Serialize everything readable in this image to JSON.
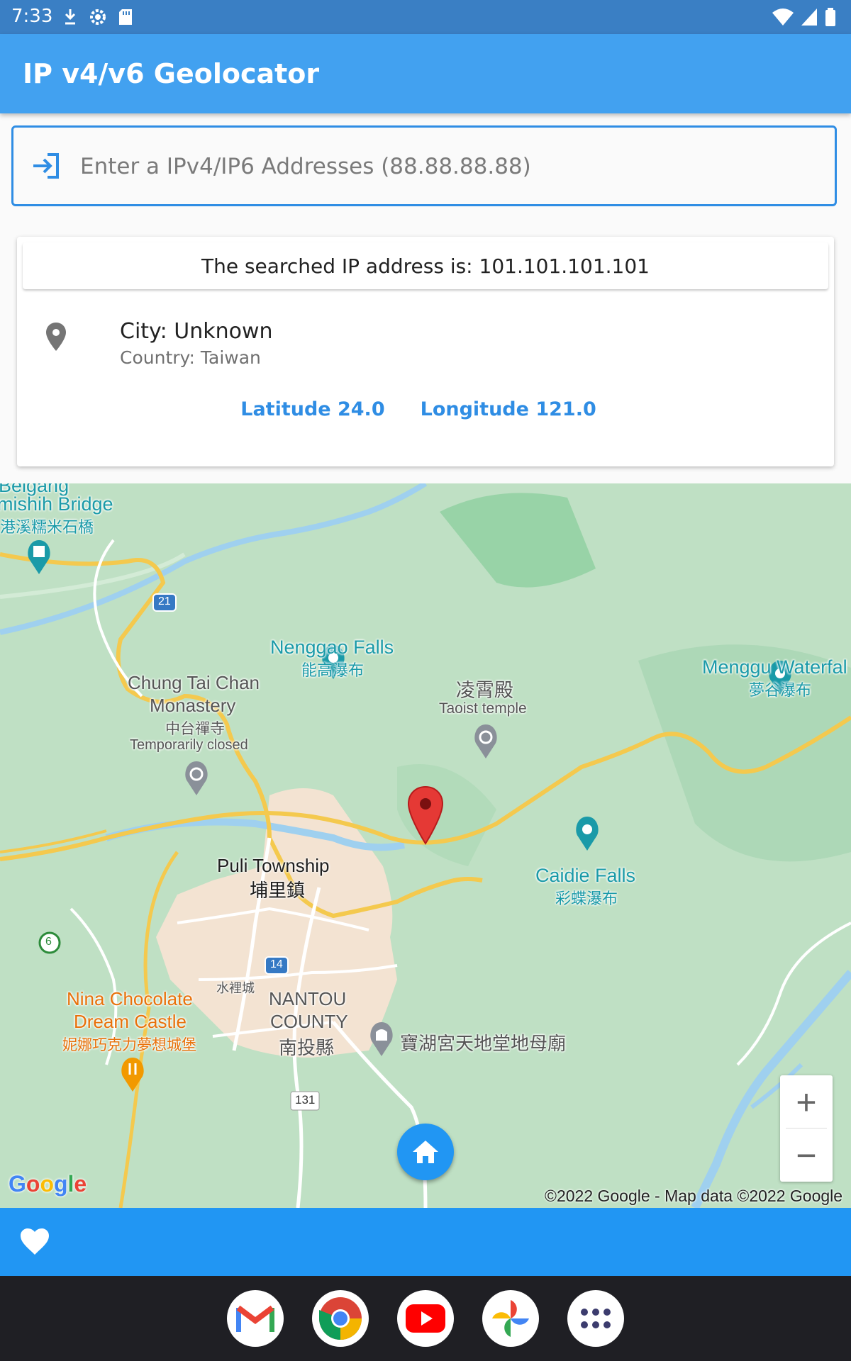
{
  "status_bar": {
    "time": "7:33"
  },
  "app_bar": {
    "title": "IP v4/v6 Geolocator"
  },
  "search": {
    "placeholder": "Enter a IPv4/IP6 Addresses (88.88.88.88)",
    "value": ""
  },
  "result": {
    "header": "The searched IP address is: 101.101.101.101",
    "city": "City: Unknown",
    "country": "Country: Taiwan",
    "latitude": "Latitude 24.0",
    "longitude": "Longitude 121.0"
  },
  "map": {
    "labels": {
      "beigang": "Beigang",
      "bridge_en": "mishih Bridge",
      "bridge_zh": "港溪糯米石橋",
      "nenggao_en": "Nenggao Falls",
      "nenggao_zh": "能高瀑布",
      "temple_zh": "凌霄殿",
      "temple_en": "Taoist temple",
      "menggu_en": "Menggu Waterfal",
      "menggu_zh": "夢谷瀑布",
      "chungtai_1": "Chung Tai Chan",
      "chungtai_2": "Monastery",
      "chungtai_zh": "中台禪寺",
      "chungtai_status": "Temporarily closed",
      "caidie_en": "Caidie Falls",
      "caidie_zh": "彩蝶瀑布",
      "puli_en": "Puli Township",
      "puli_zh": "埔里鎮",
      "shuilicheng": "水裡城",
      "nantou_1": "NANTOU",
      "nantou_2": "COUNTY",
      "nantou_zh": "南投縣",
      "baohu": "寶湖宮天地堂地母廟",
      "nina_1": "Nina Chocolate",
      "nina_2": "Dream Castle",
      "nina_zh": "妮娜巧克力夢想城堡",
      "route_21": "21",
      "route_14": "14",
      "route_6": "6",
      "route_131": "131"
    },
    "logo": "Google",
    "credit": "©2022 Google - Map data ©2022 Google",
    "zoom_in": "+",
    "zoom_out": "−"
  },
  "colors": {
    "app_bar": "#42a1f0",
    "accent": "#2196f3",
    "status_bar": "#3a7fc4"
  },
  "icons": [
    "login-icon",
    "location-pin-icon",
    "home-icon",
    "heart-icon",
    "map-marker-icon"
  ],
  "dock_apps": [
    "gmail",
    "chrome",
    "youtube",
    "photos",
    "app-drawer"
  ]
}
